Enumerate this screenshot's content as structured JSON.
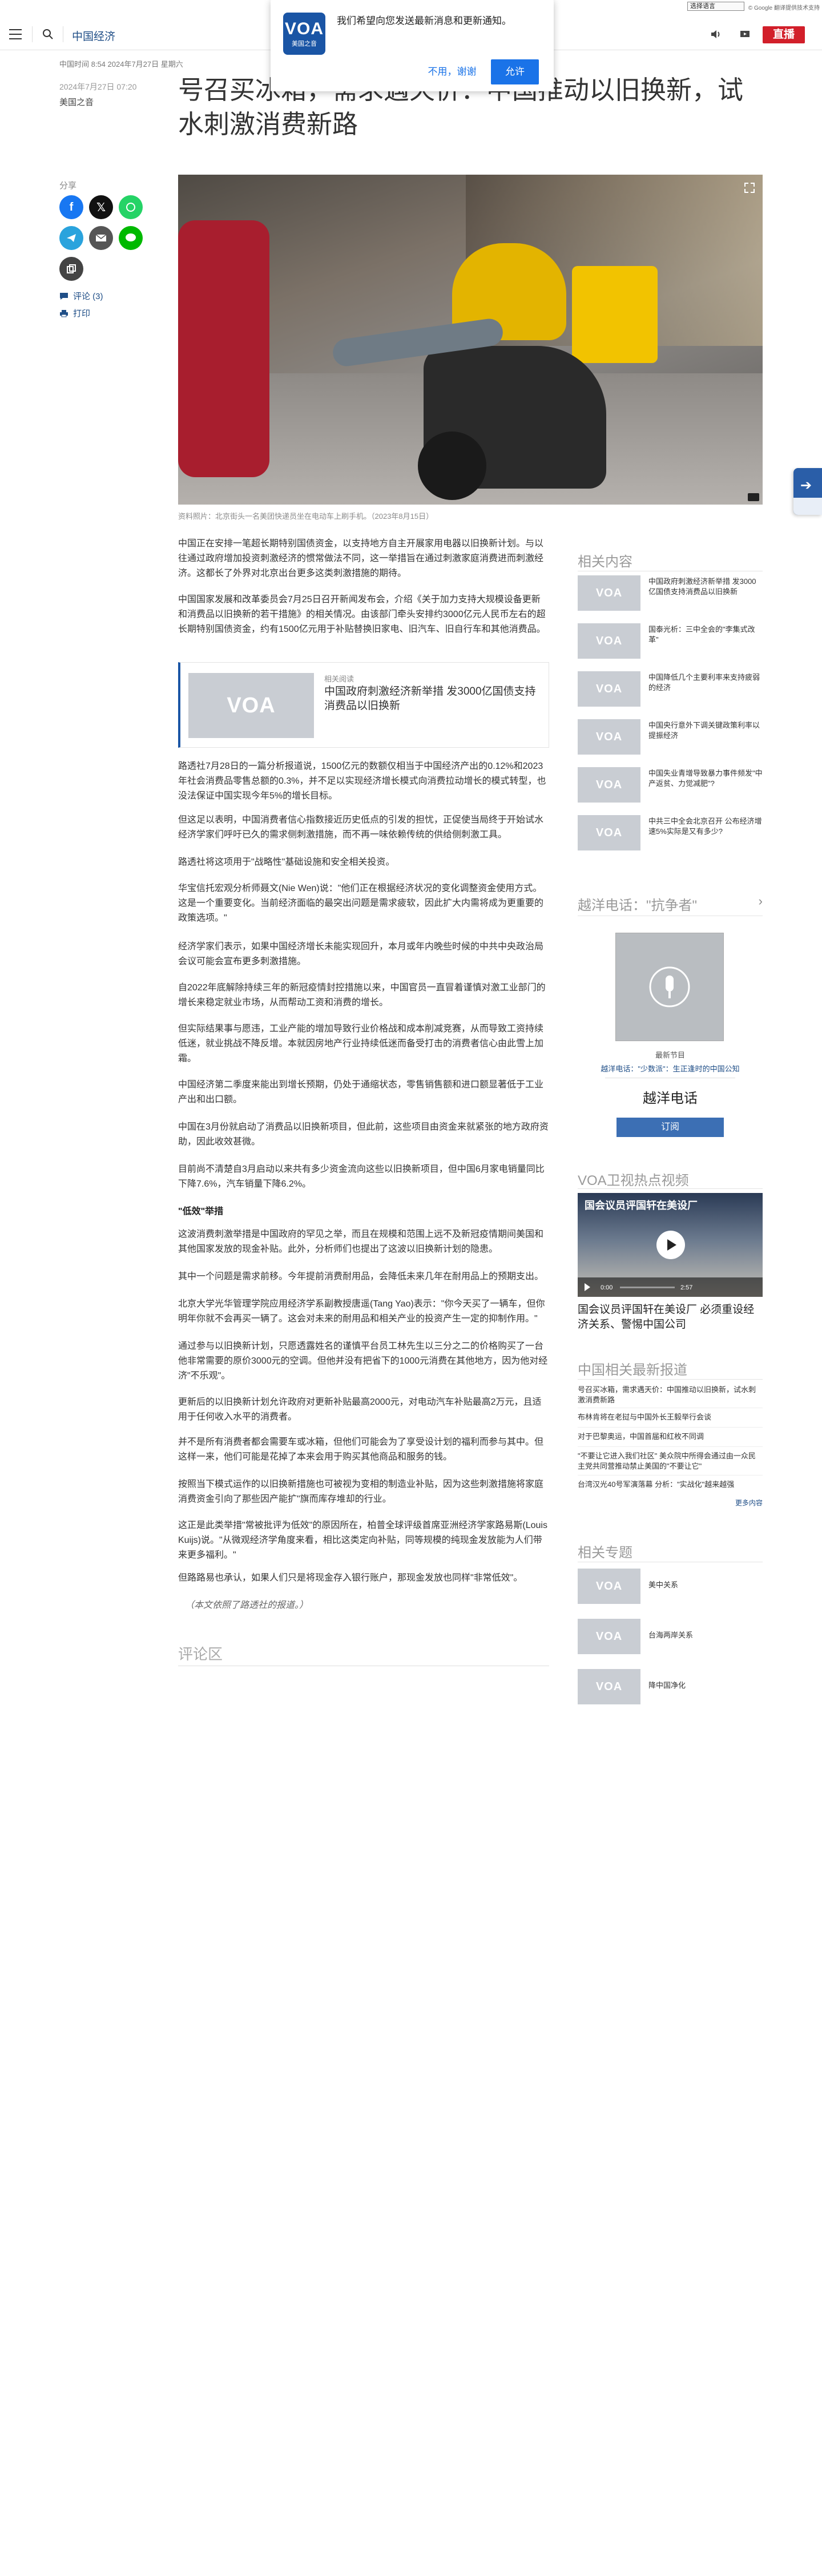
{
  "translate_bar": {
    "select_label": "选择语言",
    "powered_by": "© Google 翻译提供技术支持"
  },
  "header": {
    "section_link": "中国经济",
    "live_label": "直播"
  },
  "notification": {
    "logo_text": "VOA",
    "logo_sub": "美国之音",
    "message": "我们希望向您发送最新消息和更新通知。",
    "decline_label": "不用，谢谢",
    "accept_label": "允许"
  },
  "article": {
    "times": "中国时间 8:54 2024年7月27日 星期六",
    "date": "2024年7月27日 07:20",
    "author": "美国之音",
    "headline": "号召买冰箱，需求遇天价：中国推动以旧换新，试水刺激消费新路",
    "caption": "资料照片：北京街头一名美团快递员坐在电动车上刷手机。（2023年8月15日）",
    "paragraphs_1": [
      "中国正在安排一笔超长期特别国债资金，以支持地方自主开展家用电器以旧换新计划。与以往通过政府增加投资刺激经济的惯常做法不同，这一举措旨在通过刺激家庭消费进而刺激经济。这都长了外界对北京出台更多这类刺激措施的期待。",
      "中国国家发展和改革委员会7月25日召开新闻发布会，介绍《关于加力支持大规模设备更新和消费品以旧换新的若干措施》的相关情况。由该部门牵头安排约3000亿元人民币左右的超长期特别国债资金，约有1500亿元用于补贴替换旧家电、旧汽车、旧自行车和其他消费品。"
    ],
    "related_box": {
      "thumb_text": "VOA",
      "label": "相关阅读",
      "title": "中国政府刺激经济新举措 发3000亿国债支持消费品以旧换新"
    },
    "paragraphs_2": [
      "路透社7月28日的一篇分析报道说，1500亿元的数额仅相当于中国经济产出的0.12%和2023年社会消费品零售总额的0.3%，并不足以实现经济增长模式向消费拉动增长的模式转型，也没法保证中国实现今年5%的增长目标。",
      "但这足以表明，中国消费者信心指数接近历史低点的引发的担忧，正促使当局终于开始试水经济学家们呼吁已久的需求侧刺激措施，而不再一味依赖传统的供给侧刺激工具。",
      "路透社将这项用于\"战略性\"基础设施和安全相关投资。",
      "华宝信托宏观分析师聂文(Nie Wen)说：\"他们正在根据经济状况的变化调整资金使用方式。这是一个重要变化。当前经济面临的最突出问题是需求疲软，因此扩大内需将成为更重要的政策选项。\"",
      "经济学家们表示，如果中国经济增长未能实现回升，本月或年内晚些时候的中共中央政治局会议可能会宣布更多刺激措施。",
      "自2022年底解除持续三年的新冠疫情封控措施以来，中国官员一直冒着谨慎对激工业部门的增长来稳定就业市场，从而帮动工资和消费的增长。",
      "但实际结果事与愿违，工业产能的增加导致行业价格战和成本削减竞赛，从而导致工资持续低迷，就业挑战不降反增。本就因房地产行业持续低迷而备受打击的消费者信心由此雪上加霜。",
      "中国经济第二季度来能出到增长预期，仍处于通缩状态，零售销售额和进口额显著低于工业产出和出口额。",
      "中国在3月份就启动了消费品以旧换新项目，但此前，这些项目由资金来就紧张的地方政府资助，因此收效甚微。",
      "目前尚不清楚自3月启动以来共有多少资金流向这些以旧换新项目，但中国6月家电销量同比下降7.6%，汽车销量下降6.2%。"
    ],
    "subhead": "\"低效\"举措",
    "paragraphs_3": [
      "这波消费刺激举措是中国政府的罕见之举，而且在规模和范围上远不及新冠疫情期间美国和其他国家发放的现金补贴。此外，分析师们也提出了这波以旧换新计划的隐患。",
      "其中一个问题是需求前移。今年提前消费耐用品，会降低未来几年在耐用品上的预期支出。",
      "北京大学光华管理学院应用经济学系副教授唐遥(Tang Yao)表示：\"你今天买了一辆车，但你明年你就不会再买一辆了。这会对未来的耐用品和相关产业的投资产生一定的抑制作用。\"",
      "通过参与以旧换新计划，只愿透露姓名的谨慎平台员工林先生以三分之二的价格购买了一台他非常需要的原价3000元的空调。但他并没有把省下的1000元消费在其他地方，因为他对经济\"不乐观\"。",
      "更新后的以旧换新计划允许政府对更新补贴最高2000元，对电动汽车补贴最高2万元，且适用于任何收入水平的消费者。",
      "并不是所有消费者都会需要车或冰箱，但他们可能会为了享受设计划的福利而参与其中。但这样一来，他们可能是花掉了本来会用于购买其他商品和服务的钱。",
      "按照当下模式运作的以旧换新措施也可被视为变相的制造业补贴，因为这些刺激措施将家庭消费资金引向了那些因产能扩\"旗而库存堆却的行业。",
      "这正是此类举措\"常被批评为低效\"的原因所在，柏普全球评级首席亚洲经济学家路易斯(Louis Kuijs)说。\"从微观经济学角度来看，相比这类定向补贴，同等规模的纯现金发放能为人们带来更多福利。\"",
      "但路路易也承认，如果人们只是将现金存入银行账户，那现金发放也同样\"非常低效\"。"
    ],
    "source_note": "（本文依照了路透社的报道。）",
    "comments_title": "评论区"
  },
  "share": {
    "label": "分享",
    "comments_link": "评论 (3)",
    "print_link": "打印"
  },
  "sidebar": {
    "related_title": "相关内容",
    "related_items": [
      {
        "thumb": "VOA",
        "text": "中国政府刺激经济新举措 发3000亿国债支持消费品以旧换新"
      },
      {
        "thumb": "VOA",
        "text": "国泰光析：三中全会的\"李集式改革\""
      },
      {
        "thumb": "VOA",
        "text": "中国降低几个主要利率来支持疲弱的经济"
      },
      {
        "thumb": "VOA",
        "text": "中国央行意外下调关键政策利率以提振经济"
      },
      {
        "thumb": "VOA",
        "text": "中国失业青增导致暴力事件频发\"中产返贫、力觉减肥\"?"
      },
      {
        "thumb": "VOA",
        "text": "中共三中全会北京召开 公布经济增速5%实际是又有多少?"
      }
    ],
    "radio_title": "越洋电话：\"抗争者\"",
    "program_new": "最新节目",
    "program_link": "越洋电话：\"少数派\"：生正逢时的中国公知",
    "program_name": "越洋电话",
    "subscribe_label": "订阅",
    "video_title": "VOA卫视热点视频",
    "video_overlay_title": "国会议员评国轩在美设厂",
    "video_time": "0:00",
    "video_duration": "2:57",
    "video_caption": "国会议员评国轩在美设厂 必须重设经济关系、警惕中国公司",
    "news_title": "中国相关最新报道",
    "news_items": [
      "号召买冰箱，需求遇天价：中国推动以旧换新，试水刺激消费新路",
      "布林肯将在老挝与中国外长王毅举行会谈",
      "对于巴黎奥运，中国首届和红枚不同调",
      "\"不要让它进入我们社区\" 美众院中所得会通过由一众民主党共同营推动禁止美国的\"不要让它\"",
      "台湾汉光40号军演落幕 分析：\"实战化\"越来越强"
    ],
    "news_more": "更多内容",
    "topics_title": "相关专题",
    "topics": [
      {
        "thumb": "VOA",
        "text": "美中关系"
      },
      {
        "thumb": "VOA",
        "text": "台海两岸关系"
      },
      {
        "thumb": "VOA",
        "text": "降中国净化"
      }
    ]
  },
  "colors": {
    "brand_blue": "#1a55a5",
    "live_red": "#d21f2a",
    "link_blue": "#1f4e87"
  }
}
